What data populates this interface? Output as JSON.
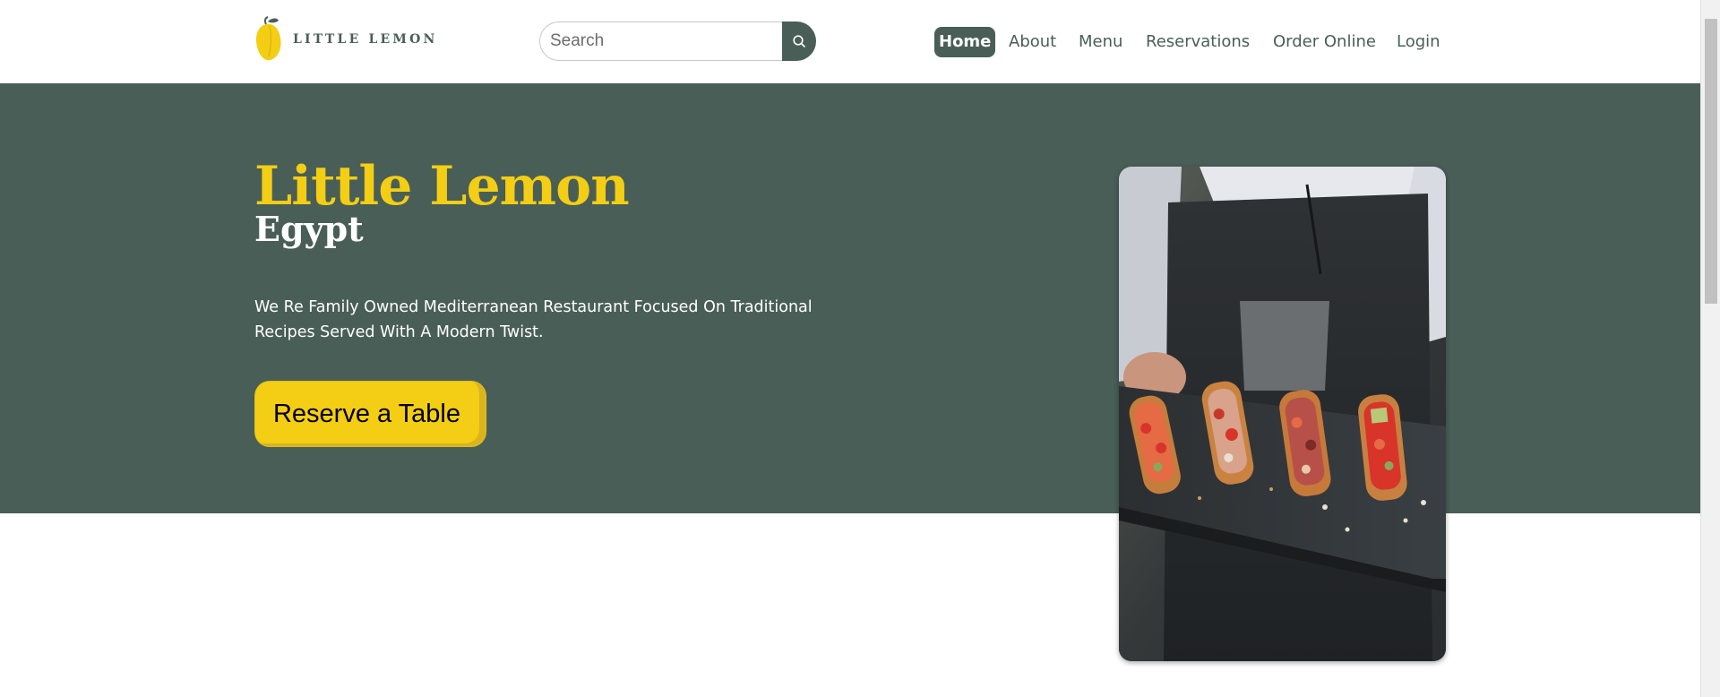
{
  "brand": {
    "name": "LITTLE LEMON",
    "icon": "lemon-icon",
    "colors": {
      "primary": "#495e57",
      "accent": "#f4ce14"
    }
  },
  "search": {
    "placeholder": "Search",
    "value": "",
    "button_icon": "search-icon"
  },
  "nav": {
    "items": [
      {
        "label": "Home",
        "active": true
      },
      {
        "label": "About",
        "active": false
      },
      {
        "label": "Menu",
        "active": false
      },
      {
        "label": "Reservations",
        "active": false
      },
      {
        "label": "Order Online",
        "active": false
      },
      {
        "label": "Login",
        "active": false
      }
    ]
  },
  "hero": {
    "title": "Little Lemon",
    "subtitle": "Egypt",
    "description": "We Re Family Owned Mediterranean Restaurant Focused On Traditional Recipes Served With A Modern Twist.",
    "cta_label": "Reserve a Table",
    "image_alt": "Chef holding a slate tray of bruschetta"
  }
}
